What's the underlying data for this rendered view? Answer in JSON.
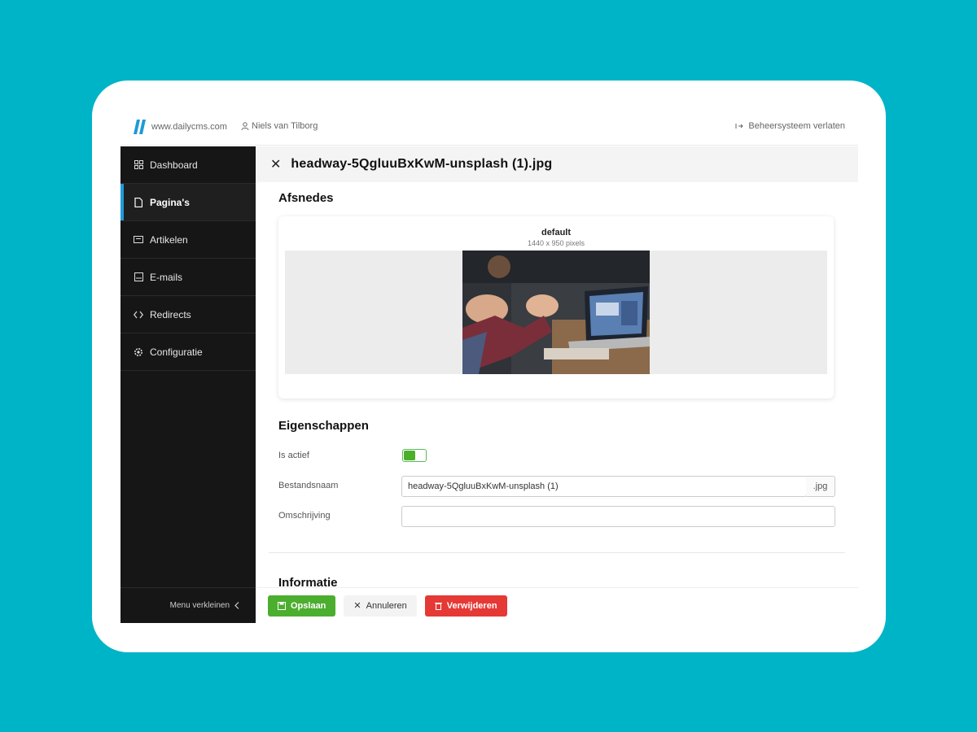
{
  "topbar": {
    "domain": "www.dailycms.com",
    "user": "Niels van Tilborg",
    "leave": "Beheersysteem verlaten"
  },
  "sidebar": {
    "items": [
      {
        "label": "Dashboard",
        "icon": "dashboard-icon"
      },
      {
        "label": "Pagina's",
        "icon": "page-icon",
        "active": true
      },
      {
        "label": "Artikelen",
        "icon": "article-icon"
      },
      {
        "label": "E-mails",
        "icon": "email-icon"
      },
      {
        "label": "Redirects",
        "icon": "redirect-icon"
      },
      {
        "label": "Configuratie",
        "icon": "gear-icon"
      }
    ],
    "collapse_label": "Menu verkleinen"
  },
  "main": {
    "title": "headway-5QgluuBxKwM-unsplash (1).jpg",
    "crops_title": "Afsnedes",
    "crop": {
      "name": "default",
      "size": "1440 x 950 pixels"
    },
    "properties_title": "Eigenschappen",
    "fields": {
      "active_label": "Is actief",
      "active_value": true,
      "filename_label": "Bestandsnaam",
      "filename_value": "headway-5QgluuBxKwM-unsplash (1)",
      "filename_suffix": ".jpg",
      "description_label": "Omschrijving",
      "description_value": ""
    },
    "info_title": "Informatie"
  },
  "footer": {
    "save": "Opslaan",
    "cancel": "Annuleren",
    "delete": "Verwijderen"
  },
  "colors": {
    "background": "#00b4c8",
    "sidebar": "#161616",
    "active_accent": "#1e9ad6",
    "save": "#4cae2e",
    "delete": "#e53935"
  }
}
